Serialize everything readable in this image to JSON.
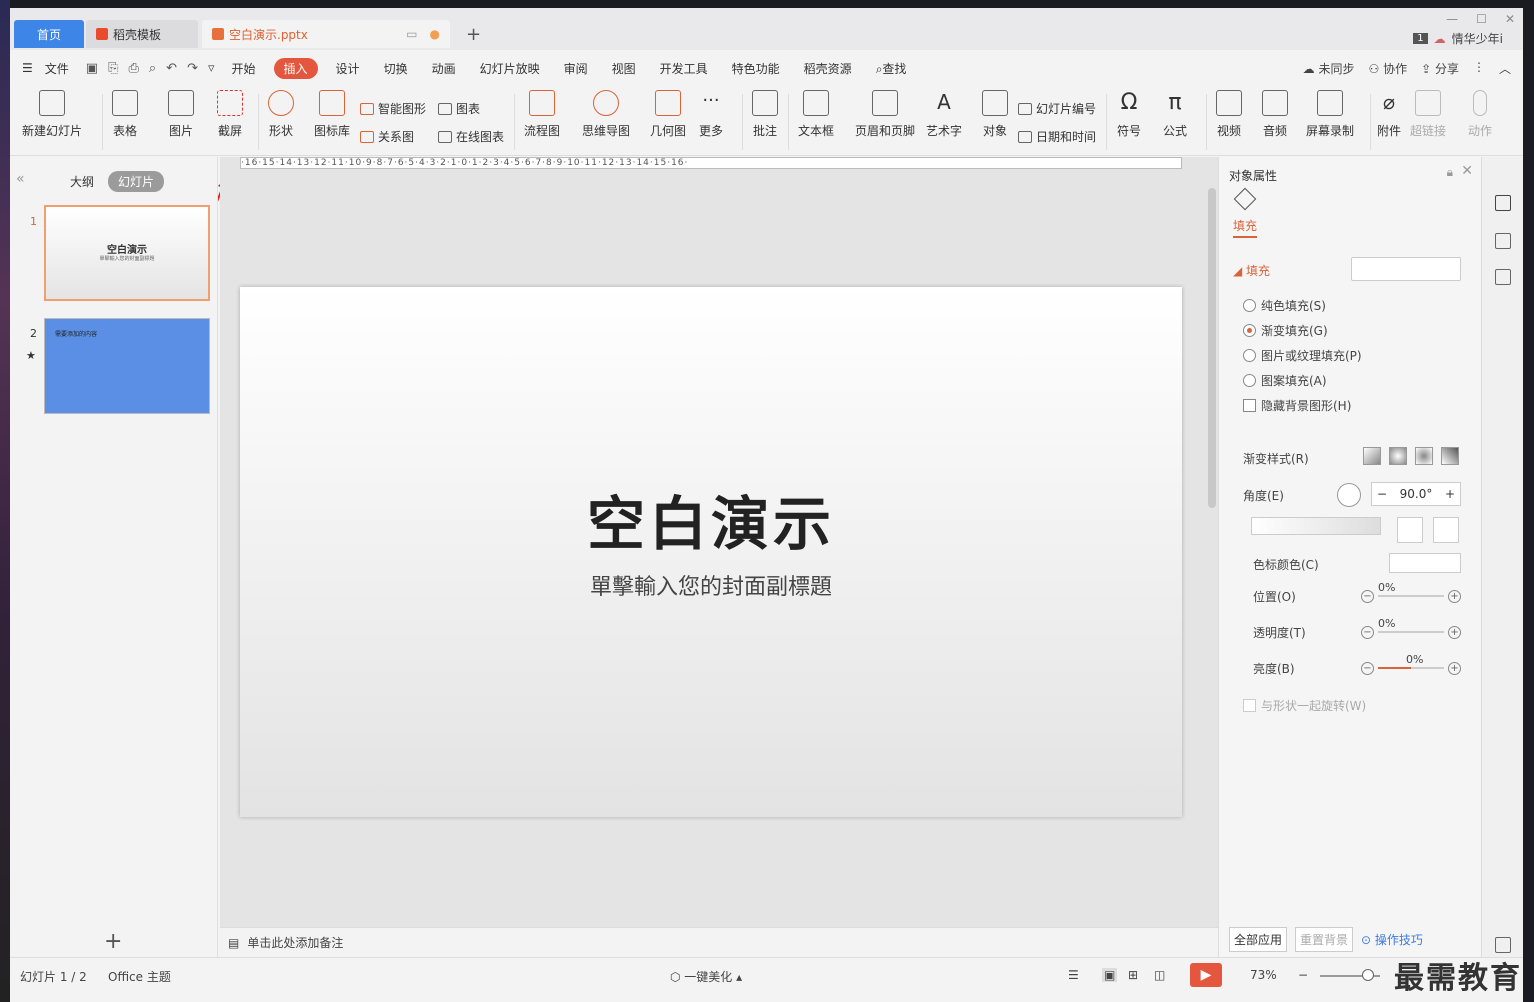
{
  "tabs": {
    "home": "首页",
    "template": "稻壳模板",
    "doc": "空白演示.pptx",
    "add": "+"
  },
  "user": {
    "page_badge": "1",
    "name": "情华少年i"
  },
  "menu": {
    "file": "文件",
    "items": [
      "开始",
      "插入",
      "设计",
      "切换",
      "动画",
      "幻灯片放映",
      "审阅",
      "视图",
      "开发工具",
      "特色功能",
      "稻壳资源"
    ],
    "search": "查找",
    "sync": "未同步",
    "collab": "协作",
    "share": "分享"
  },
  "ribbon": {
    "new_slide": "新建幻灯片",
    "table": "表格",
    "picture": "图片",
    "screenshot": "截屏",
    "shape": "形状",
    "icon_lib": "图标库",
    "smart_art": "智能图形",
    "relation": "关系图",
    "chart": "图表",
    "online_chart": "在线图表",
    "flowchart": "流程图",
    "mindmap": "思维导图",
    "geometry": "几何图",
    "more": "更多",
    "comment": "批注",
    "textbox": "文本框",
    "header_footer": "页眉和页脚",
    "wordart": "艺术字",
    "object": "对象",
    "slide_num": "幻灯片编号",
    "date_time": "日期和时间",
    "symbol": "符号",
    "formula": "公式",
    "video": "视频",
    "audio": "音频",
    "screen_rec": "屏幕录制",
    "attachment": "附件",
    "hyperlink": "超链接",
    "action": "动作"
  },
  "left_panel": {
    "outline": "大纲",
    "slides": "幻灯片",
    "thumb1_num": "1",
    "thumb1_title": "空白演示",
    "thumb1_sub": "單擊輸入您的封面副標題",
    "thumb2_num": "2",
    "thumb2_text": "需要添加的内容"
  },
  "ruler": "·16·15·14·13·12·11·10·9·8·7·6·5·4·3·2·1·0·1·2·3·4·5·6·7·8·9·10·11·12·13·14·15·16·",
  "slide": {
    "title": "空白演示",
    "subtitle": "單擊輸入您的封面副標題"
  },
  "notes": "单击此处添加备注",
  "props": {
    "title": "对象属性",
    "fill_tab": "填充",
    "fill_section": "填充",
    "solid": "纯色填充(S)",
    "gradient": "渐变填充(G)",
    "picture_fill": "图片或纹理填充(P)",
    "pattern": "图案填充(A)",
    "hide_bg": "隐藏背景图形(H)",
    "grad_style": "渐变样式(R)",
    "angle": "角度(E)",
    "angle_value": "90.0°",
    "stop_color": "色标颜色(C)",
    "position": "位置(O)",
    "position_value": "0%",
    "transparency": "透明度(T)",
    "transparency_value": "0%",
    "brightness": "亮度(B)",
    "brightness_value": "0%",
    "rotate_with": "与形状一起旋转(W)",
    "apply_all": "全部应用",
    "reset_bg": "重置背景",
    "tips": "操作技巧"
  },
  "status": {
    "slide_counter": "幻灯片 1 / 2",
    "theme": "Office 主题",
    "beautify": "一键美化",
    "zoom": "73%"
  },
  "watermark": "最需教育",
  "colors": {
    "accent": "#e4573e",
    "tab_active": "#3d86e8",
    "thumb2": "#5b8fe6"
  }
}
